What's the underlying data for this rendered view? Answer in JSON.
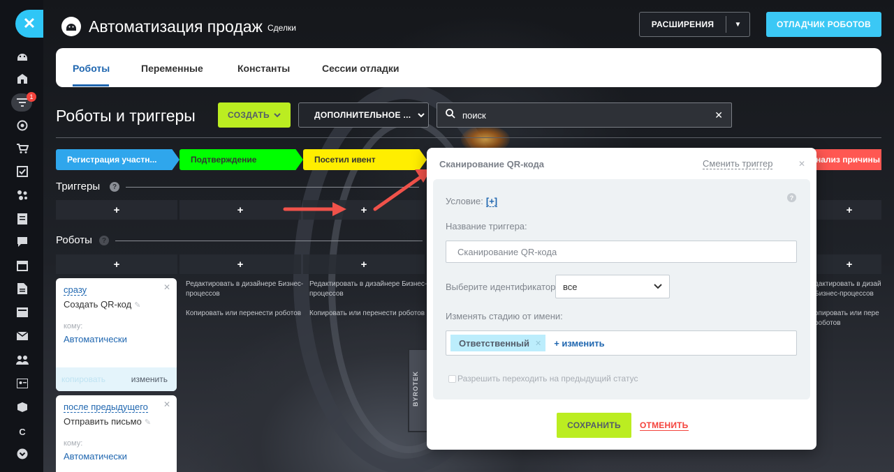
{
  "header": {
    "title": "Автоматизация продаж",
    "subtitle": "Сделки",
    "extensions_label": "РАСШИРЕНИЯ",
    "debugger_label": "ОТЛАДЧИК РОБОТОВ"
  },
  "sidebar": {
    "badge_count": "1",
    "bottom_letter": "C",
    "icons": [
      "android-icon",
      "house-icon",
      "filter-icon",
      "target-icon",
      "cart-icon",
      "checkbox-icon",
      "dots-icon",
      "document-icon",
      "chat-icon",
      "calendar-icon",
      "file-icon",
      "inbox-icon",
      "mail-icon",
      "users-icon",
      "contact-icon",
      "box-icon",
      "letter-icon",
      "chevron-down-circle-icon"
    ]
  },
  "tabs": [
    {
      "label": "Роботы",
      "active": true
    },
    {
      "label": "Переменные",
      "active": false
    },
    {
      "label": "Константы",
      "active": false
    },
    {
      "label": "Сессии отладки",
      "active": false
    }
  ],
  "toolbar": {
    "page_title": "Роботы и триггеры",
    "create_label": "СОЗДАТЬ",
    "more_label": "ДОПОЛНИТЕЛЬНОЕ ...",
    "search_placeholder": "поиск"
  },
  "stages": [
    {
      "label": "Регистрация участн...",
      "color": "#2fa6ec",
      "text_color": "#ffffff"
    },
    {
      "label": "Подтверждение",
      "color": "#00ff00",
      "text_color": "#333333"
    },
    {
      "label": "Посетил ивент",
      "color": "#ffee00",
      "text_color": "#333333"
    },
    {
      "label": "нализ причины",
      "color": "#ff5752",
      "text_color": "#ffffff"
    }
  ],
  "sections": {
    "triggers": "Триггеры",
    "robots": "Роботы",
    "help": "?",
    "add": "+"
  },
  "column_links": {
    "edit": "Редактировать в дизайнере Бизнес-процессов",
    "copy": "Копировать или перенести роботов",
    "edit_cut": "дактировать в дизай Бизнес-процессов",
    "copy_cut": "опировать или пере роботов"
  },
  "robots": [
    {
      "when": "сразу",
      "name": "Создать QR-код",
      "whom_label": "кому:",
      "whom": "Автоматически",
      "copy": "копировать",
      "edit": "изменить"
    },
    {
      "when": "после предыдущего",
      "name": "Отправить письмо",
      "whom_label": "кому:",
      "whom": "Автоматически"
    }
  ],
  "modal": {
    "title": "Сканирование QR-кода",
    "change_trigger": "Сменить триггер",
    "condition_label": "Условие:",
    "condition_link": "[+]",
    "name_label": "Название триггера:",
    "name_value": "Сканирование QR-кода",
    "identifier_label": "Выберите идентификатор:",
    "identifier_value": "все",
    "change_stage_label": "Изменять стадию от имени:",
    "responsible_tag": "Ответственный",
    "add_change": "+ изменить",
    "allow_prev_label": "Разрешить переходить на предыдущий статус",
    "save_label": "СОХРАНИТЬ",
    "cancel_label": "ОТМЕНИТЬ"
  },
  "colors": {
    "accent_blue": "#2067b0",
    "lime": "#bbed21",
    "cyan": "#3bc8f5",
    "annotation_arrow": "#f0524a"
  }
}
